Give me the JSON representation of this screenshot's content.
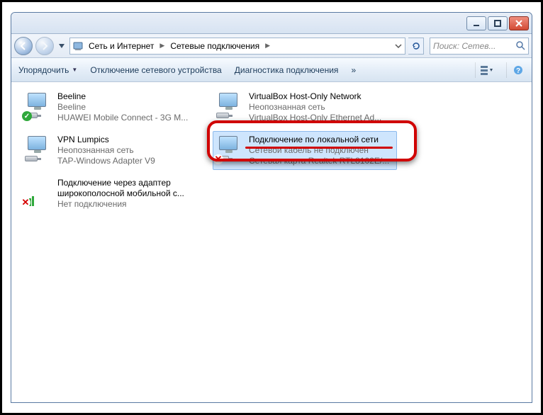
{
  "titlebar": {},
  "nav": {
    "crumb1": "Сеть и Интернет",
    "crumb2": "Сетевые подключения"
  },
  "search": {
    "placeholder": "Поиск: Сетев..."
  },
  "toolbar": {
    "organize": "Упорядочить",
    "disable": "Отключение сетевого устройства",
    "diagnose": "Диагностика подключения",
    "more": "»"
  },
  "connections": [
    {
      "name": "Beeline",
      "line2": "Beeline",
      "line3": "HUAWEI Mobile Connect - 3G M...",
      "status": "ok"
    },
    {
      "name": "VirtualBox Host-Only Network",
      "line2": "Неопознанная сеть",
      "line3": "VirtualBox Host-Only Ethernet Ad...",
      "status": "none"
    },
    {
      "name": "VPN Lumpics",
      "line2": "Неопознанная сеть",
      "line3": "TAP-Windows Adapter V9",
      "status": "none"
    },
    {
      "name": "Подключение по локальной сети",
      "line2": "Сетевой кабель не подключен",
      "line3": "Сетевая карта Realtek RTL8102E/...",
      "status": "x"
    },
    {
      "name_l1": "Подключение через адаптер",
      "name_l2": "широкополосной мобильной с...",
      "line3": "Нет подключения",
      "status": "barsx"
    }
  ]
}
